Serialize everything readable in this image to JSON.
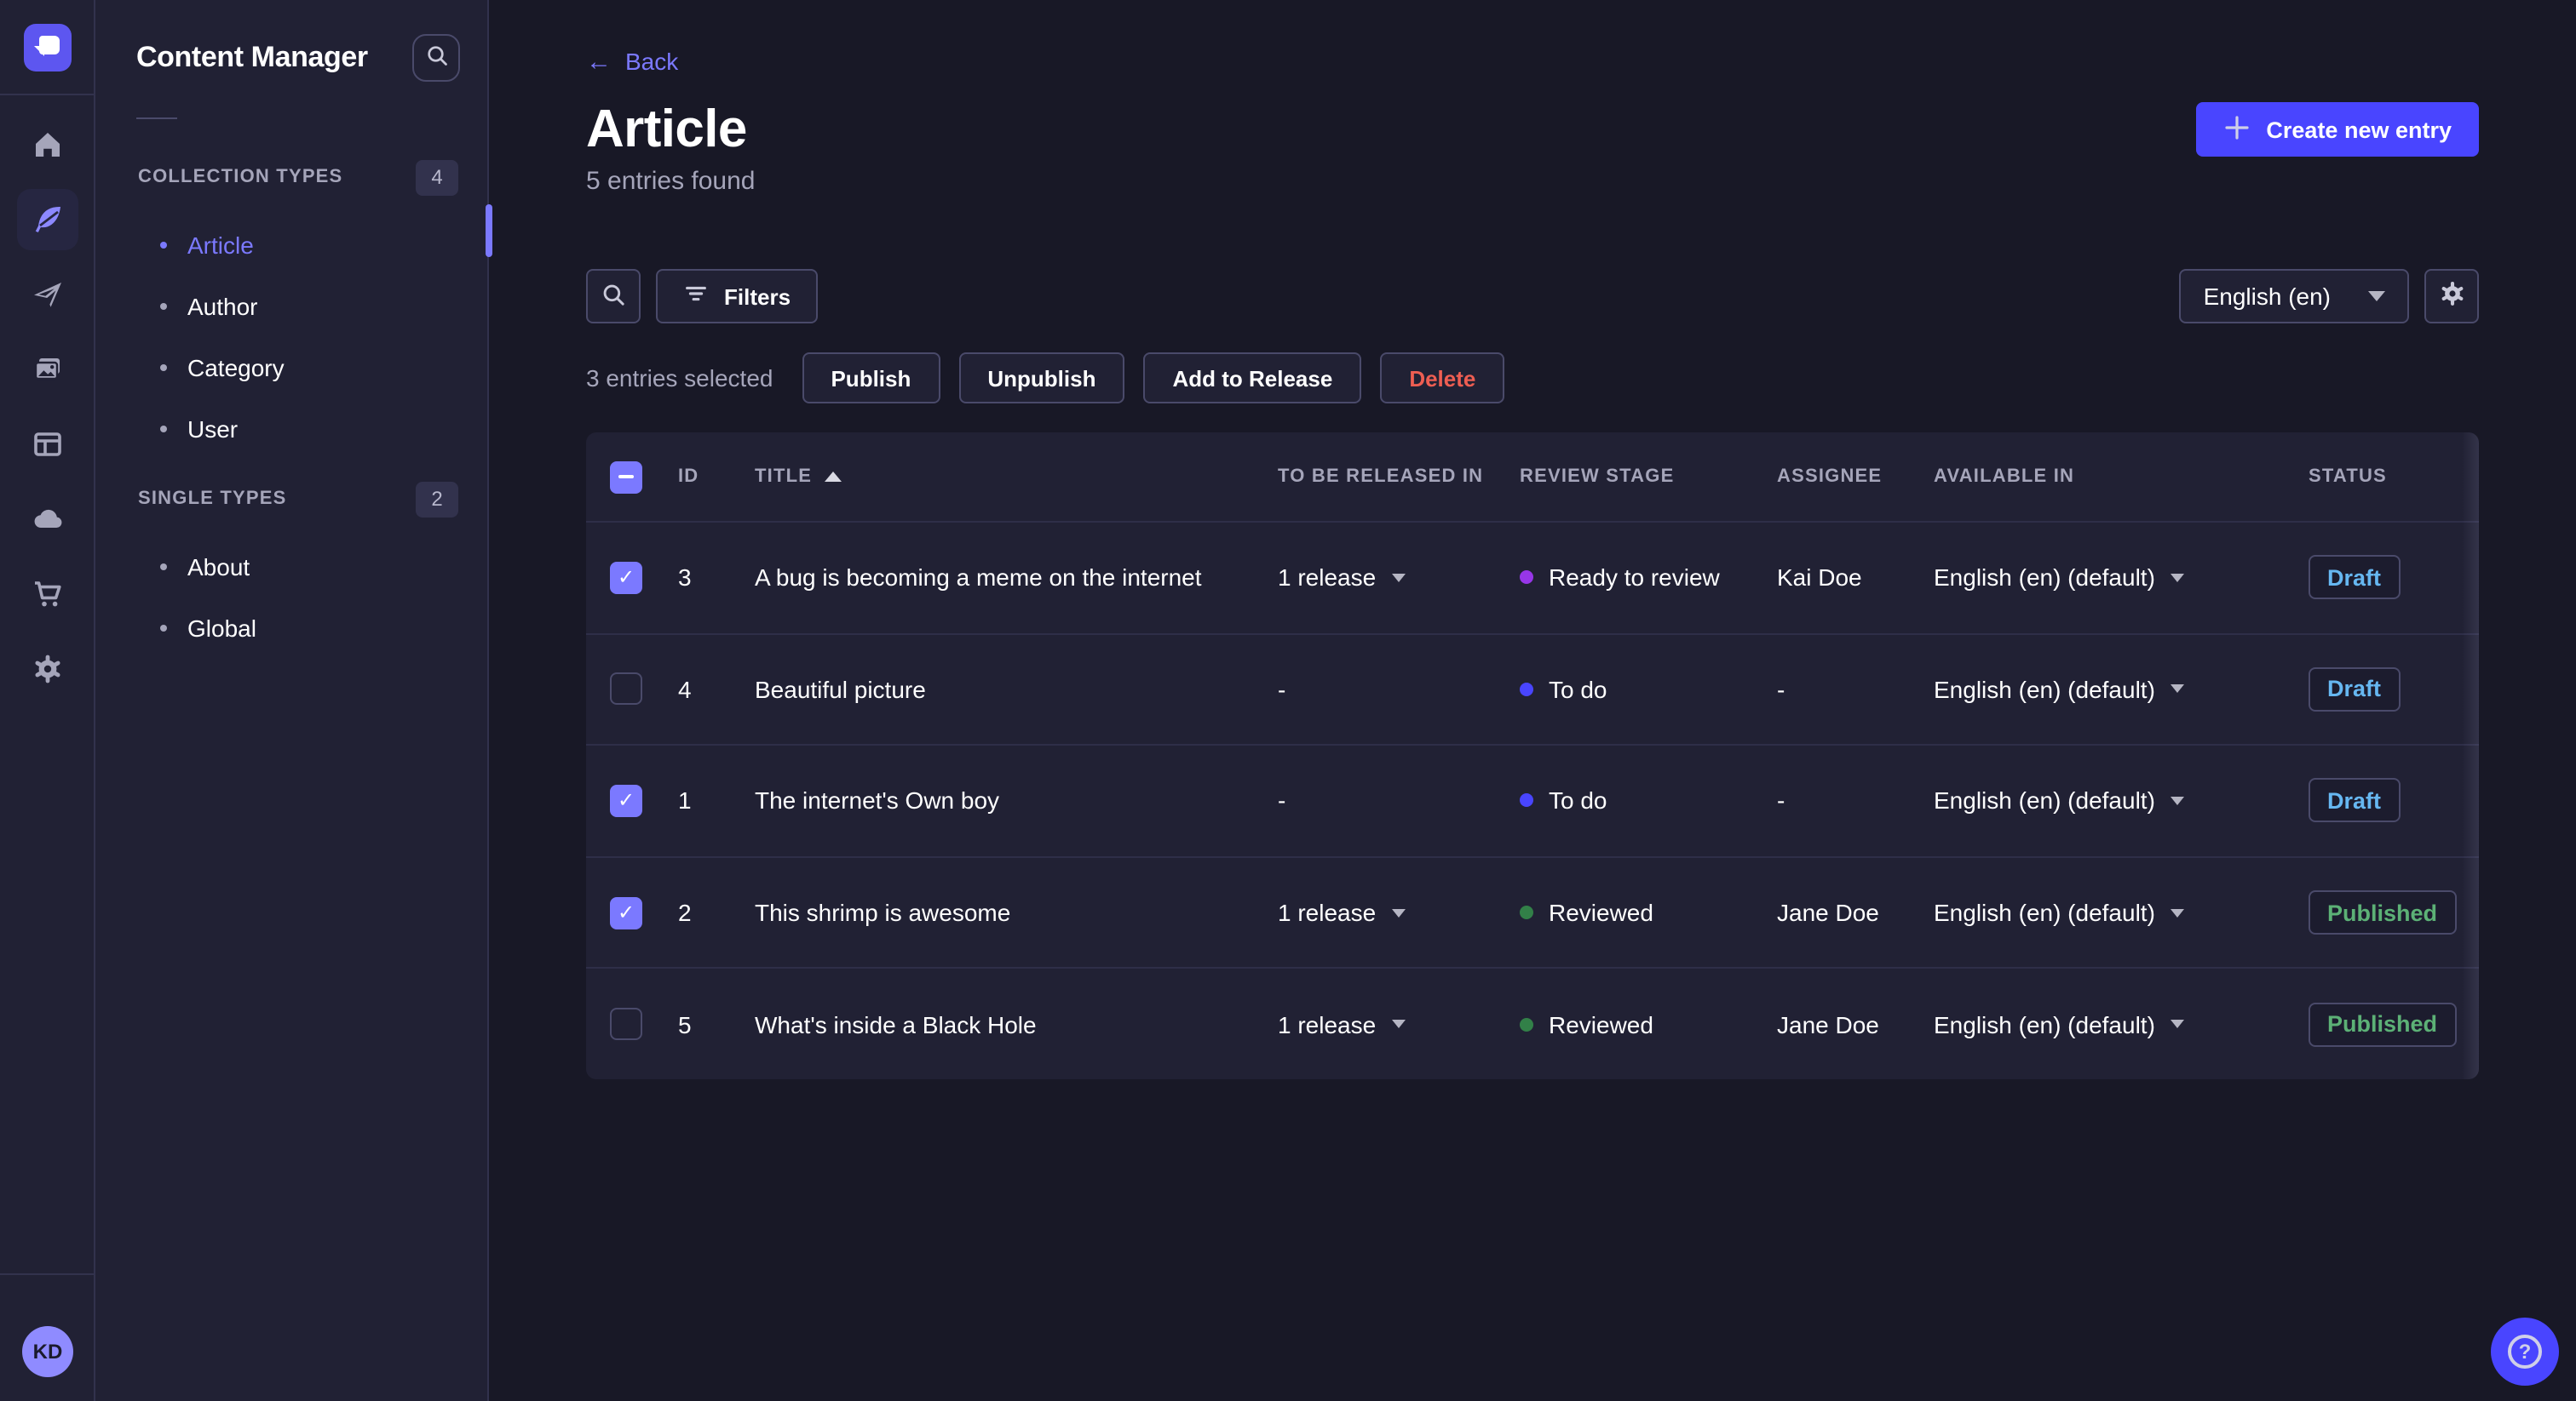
{
  "colors": {
    "background": "#181826",
    "panel": "#212134",
    "border": "#32324d",
    "control_border": "#4a4a6a",
    "text_muted": "#a5a5ba",
    "primary": "#4945ff",
    "primary_light": "#7b79ff",
    "danger": "#ee5e52",
    "status_draft": "#66b7f1",
    "status_published": "#5cb176",
    "stage_ready_to_review": "#9736e8",
    "stage_to_do": "#4945ff",
    "stage_reviewed": "#328048"
  },
  "rail": {
    "icons": [
      {
        "name": "home-icon",
        "active": false
      },
      {
        "name": "feather-content-icon",
        "active": true
      },
      {
        "name": "paper-plane-icon",
        "active": false
      },
      {
        "name": "images-icon",
        "active": false
      },
      {
        "name": "layout-icon",
        "active": false
      },
      {
        "name": "cloud-icon",
        "active": false
      },
      {
        "name": "cart-icon",
        "active": false
      },
      {
        "name": "gear-icon",
        "active": false
      }
    ],
    "avatar_initials": "KD"
  },
  "subnav": {
    "title": "Content Manager",
    "sections": [
      {
        "label": "COLLECTION TYPES",
        "count": "4",
        "items": [
          {
            "label": "Article",
            "active": true
          },
          {
            "label": "Author",
            "active": false
          },
          {
            "label": "Category",
            "active": false
          },
          {
            "label": "User",
            "active": false
          }
        ]
      },
      {
        "label": "SINGLE TYPES",
        "count": "2",
        "items": [
          {
            "label": "About",
            "active": false
          },
          {
            "label": "Global",
            "active": false
          }
        ]
      }
    ]
  },
  "header": {
    "back_label": "Back",
    "back_arrow": "←",
    "title": "Article",
    "subtitle": "5 entries found",
    "create_button": "Create new entry"
  },
  "toolbar": {
    "filters_label": "Filters",
    "locale_selected": "English (en)"
  },
  "selection": {
    "text": "3 entries selected",
    "actions": [
      "Publish",
      "Unpublish",
      "Add to Release",
      "Delete"
    ]
  },
  "table": {
    "columns": [
      "ID",
      "TITLE",
      "TO BE RELEASED IN",
      "REVIEW STAGE",
      "ASSIGNEE",
      "AVAILABLE IN",
      "STATUS"
    ],
    "sort": {
      "column": "TITLE",
      "direction": "asc"
    },
    "rows": [
      {
        "selected": true,
        "id": "3",
        "title": "A bug is becoming a meme on the internet",
        "release": "1 release",
        "stage": "Ready to review",
        "assignee": "Kai Doe",
        "available": "English (en) (default)",
        "status": "Draft"
      },
      {
        "selected": false,
        "id": "4",
        "title": "Beautiful picture",
        "release": "-",
        "stage": "To do",
        "assignee": "-",
        "available": "English (en) (default)",
        "status": "Draft"
      },
      {
        "selected": true,
        "id": "1",
        "title": "The internet's Own boy",
        "release": "-",
        "stage": "To do",
        "assignee": "-",
        "available": "English (en) (default)",
        "status": "Draft"
      },
      {
        "selected": true,
        "id": "2",
        "title": "This shrimp is awesome",
        "release": "1 release",
        "stage": "Reviewed",
        "assignee": "Jane Doe",
        "available": "English (en) (default)",
        "status": "Published"
      },
      {
        "selected": false,
        "id": "5",
        "title": "What's inside a Black Hole",
        "release": "1 release",
        "stage": "Reviewed",
        "assignee": "Jane Doe",
        "available": "English (en) (default)",
        "status": "Published"
      }
    ]
  },
  "help": {
    "glyph": "?"
  }
}
